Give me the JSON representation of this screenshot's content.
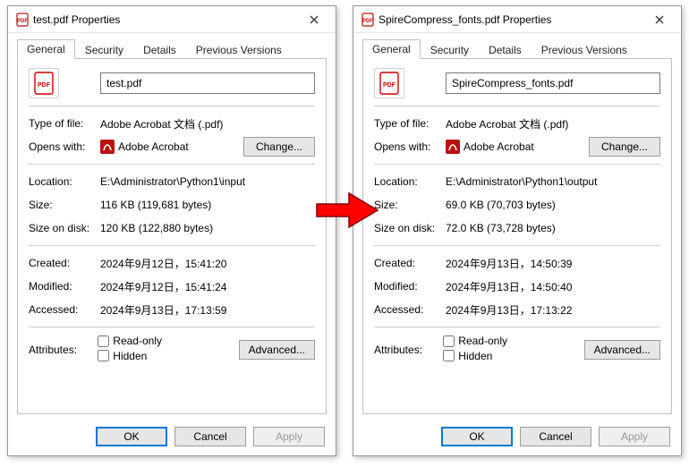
{
  "tabs": {
    "general": "General",
    "security": "Security",
    "details": "Details",
    "previous": "Previous Versions"
  },
  "labels": {
    "type_of_file": "Type of file:",
    "opens_with": "Opens with:",
    "location": "Location:",
    "size": "Size:",
    "size_on_disk": "Size on disk:",
    "created": "Created:",
    "modified": "Modified:",
    "accessed": "Accessed:",
    "attributes": "Attributes:",
    "readonly": "Read-only",
    "hidden": "Hidden"
  },
  "buttons": {
    "change": "Change...",
    "advanced": "Advanced...",
    "ok": "OK",
    "cancel": "Cancel",
    "apply": "Apply"
  },
  "common": {
    "file_type": "Adobe Acrobat 文档 (.pdf)",
    "opens_with_app": "Adobe Acrobat"
  },
  "left": {
    "title": "test.pdf Properties",
    "filename": "test.pdf",
    "location": "E:\\Administrator\\Python1\\input",
    "size": "116 KB (119,681 bytes)",
    "size_on_disk": "120 KB (122,880 bytes)",
    "created": "2024年9月12日，15:41:20",
    "modified": "2024年9月12日，15:41:24",
    "accessed": "2024年9月13日，17:13:59"
  },
  "right": {
    "title": "SpireCompress_fonts.pdf Properties",
    "filename": "SpireCompress_fonts.pdf",
    "location": "E:\\Administrator\\Python1\\output",
    "size": "69.0 KB (70,703 bytes)",
    "size_on_disk": "72.0 KB (73,728 bytes)",
    "created": "2024年9月13日，14:50:39",
    "modified": "2024年9月13日，14:50:40",
    "accessed": "2024年9月13日，17:13:22"
  }
}
